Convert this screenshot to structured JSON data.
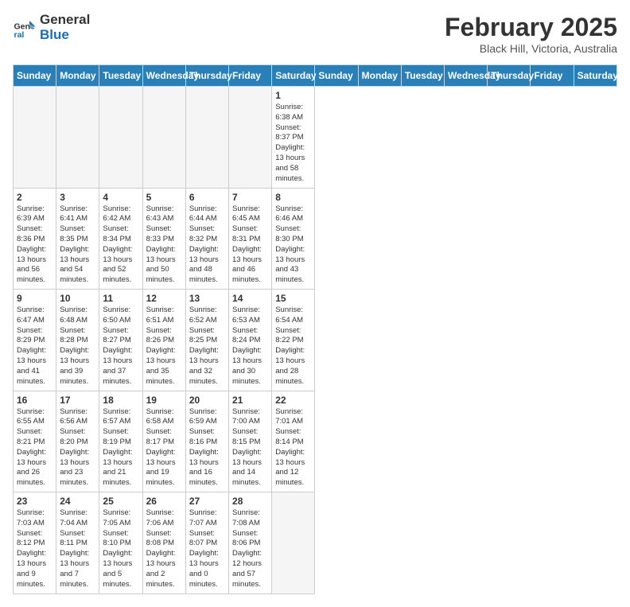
{
  "header": {
    "logo_general": "General",
    "logo_blue": "Blue",
    "month_title": "February 2025",
    "location": "Black Hill, Victoria, Australia"
  },
  "weekdays": [
    "Sunday",
    "Monday",
    "Tuesday",
    "Wednesday",
    "Thursday",
    "Friday",
    "Saturday"
  ],
  "weeks": [
    [
      {
        "day": "",
        "info": ""
      },
      {
        "day": "",
        "info": ""
      },
      {
        "day": "",
        "info": ""
      },
      {
        "day": "",
        "info": ""
      },
      {
        "day": "",
        "info": ""
      },
      {
        "day": "",
        "info": ""
      },
      {
        "day": "1",
        "info": "Sunrise: 6:38 AM\nSunset: 8:37 PM\nDaylight: 13 hours and 58 minutes."
      }
    ],
    [
      {
        "day": "2",
        "info": "Sunrise: 6:39 AM\nSunset: 8:36 PM\nDaylight: 13 hours and 56 minutes."
      },
      {
        "day": "3",
        "info": "Sunrise: 6:41 AM\nSunset: 8:35 PM\nDaylight: 13 hours and 54 minutes."
      },
      {
        "day": "4",
        "info": "Sunrise: 6:42 AM\nSunset: 8:34 PM\nDaylight: 13 hours and 52 minutes."
      },
      {
        "day": "5",
        "info": "Sunrise: 6:43 AM\nSunset: 8:33 PM\nDaylight: 13 hours and 50 minutes."
      },
      {
        "day": "6",
        "info": "Sunrise: 6:44 AM\nSunset: 8:32 PM\nDaylight: 13 hours and 48 minutes."
      },
      {
        "day": "7",
        "info": "Sunrise: 6:45 AM\nSunset: 8:31 PM\nDaylight: 13 hours and 46 minutes."
      },
      {
        "day": "8",
        "info": "Sunrise: 6:46 AM\nSunset: 8:30 PM\nDaylight: 13 hours and 43 minutes."
      }
    ],
    [
      {
        "day": "9",
        "info": "Sunrise: 6:47 AM\nSunset: 8:29 PM\nDaylight: 13 hours and 41 minutes."
      },
      {
        "day": "10",
        "info": "Sunrise: 6:48 AM\nSunset: 8:28 PM\nDaylight: 13 hours and 39 minutes."
      },
      {
        "day": "11",
        "info": "Sunrise: 6:50 AM\nSunset: 8:27 PM\nDaylight: 13 hours and 37 minutes."
      },
      {
        "day": "12",
        "info": "Sunrise: 6:51 AM\nSunset: 8:26 PM\nDaylight: 13 hours and 35 minutes."
      },
      {
        "day": "13",
        "info": "Sunrise: 6:52 AM\nSunset: 8:25 PM\nDaylight: 13 hours and 32 minutes."
      },
      {
        "day": "14",
        "info": "Sunrise: 6:53 AM\nSunset: 8:24 PM\nDaylight: 13 hours and 30 minutes."
      },
      {
        "day": "15",
        "info": "Sunrise: 6:54 AM\nSunset: 8:22 PM\nDaylight: 13 hours and 28 minutes."
      }
    ],
    [
      {
        "day": "16",
        "info": "Sunrise: 6:55 AM\nSunset: 8:21 PM\nDaylight: 13 hours and 26 minutes."
      },
      {
        "day": "17",
        "info": "Sunrise: 6:56 AM\nSunset: 8:20 PM\nDaylight: 13 hours and 23 minutes."
      },
      {
        "day": "18",
        "info": "Sunrise: 6:57 AM\nSunset: 8:19 PM\nDaylight: 13 hours and 21 minutes."
      },
      {
        "day": "19",
        "info": "Sunrise: 6:58 AM\nSunset: 8:17 PM\nDaylight: 13 hours and 19 minutes."
      },
      {
        "day": "20",
        "info": "Sunrise: 6:59 AM\nSunset: 8:16 PM\nDaylight: 13 hours and 16 minutes."
      },
      {
        "day": "21",
        "info": "Sunrise: 7:00 AM\nSunset: 8:15 PM\nDaylight: 13 hours and 14 minutes."
      },
      {
        "day": "22",
        "info": "Sunrise: 7:01 AM\nSunset: 8:14 PM\nDaylight: 13 hours and 12 minutes."
      }
    ],
    [
      {
        "day": "23",
        "info": "Sunrise: 7:03 AM\nSunset: 8:12 PM\nDaylight: 13 hours and 9 minutes."
      },
      {
        "day": "24",
        "info": "Sunrise: 7:04 AM\nSunset: 8:11 PM\nDaylight: 13 hours and 7 minutes."
      },
      {
        "day": "25",
        "info": "Sunrise: 7:05 AM\nSunset: 8:10 PM\nDaylight: 13 hours and 5 minutes."
      },
      {
        "day": "26",
        "info": "Sunrise: 7:06 AM\nSunset: 8:08 PM\nDaylight: 13 hours and 2 minutes."
      },
      {
        "day": "27",
        "info": "Sunrise: 7:07 AM\nSunset: 8:07 PM\nDaylight: 13 hours and 0 minutes."
      },
      {
        "day": "28",
        "info": "Sunrise: 7:08 AM\nSunset: 8:06 PM\nDaylight: 12 hours and 57 minutes."
      },
      {
        "day": "",
        "info": ""
      }
    ]
  ]
}
